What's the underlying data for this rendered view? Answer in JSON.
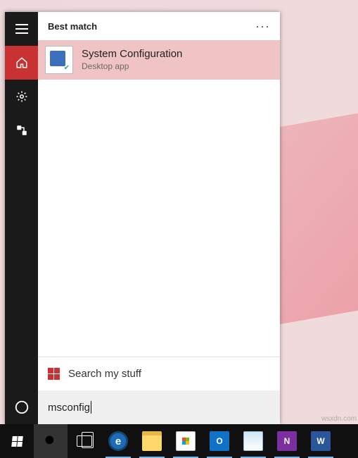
{
  "menu": {
    "category": "Best match",
    "result": {
      "title": "System Configuration",
      "subtitle": "Desktop app"
    },
    "my_stuff": "Search my stuff",
    "query": "msconfig"
  },
  "watermark": "wsxdn.com"
}
